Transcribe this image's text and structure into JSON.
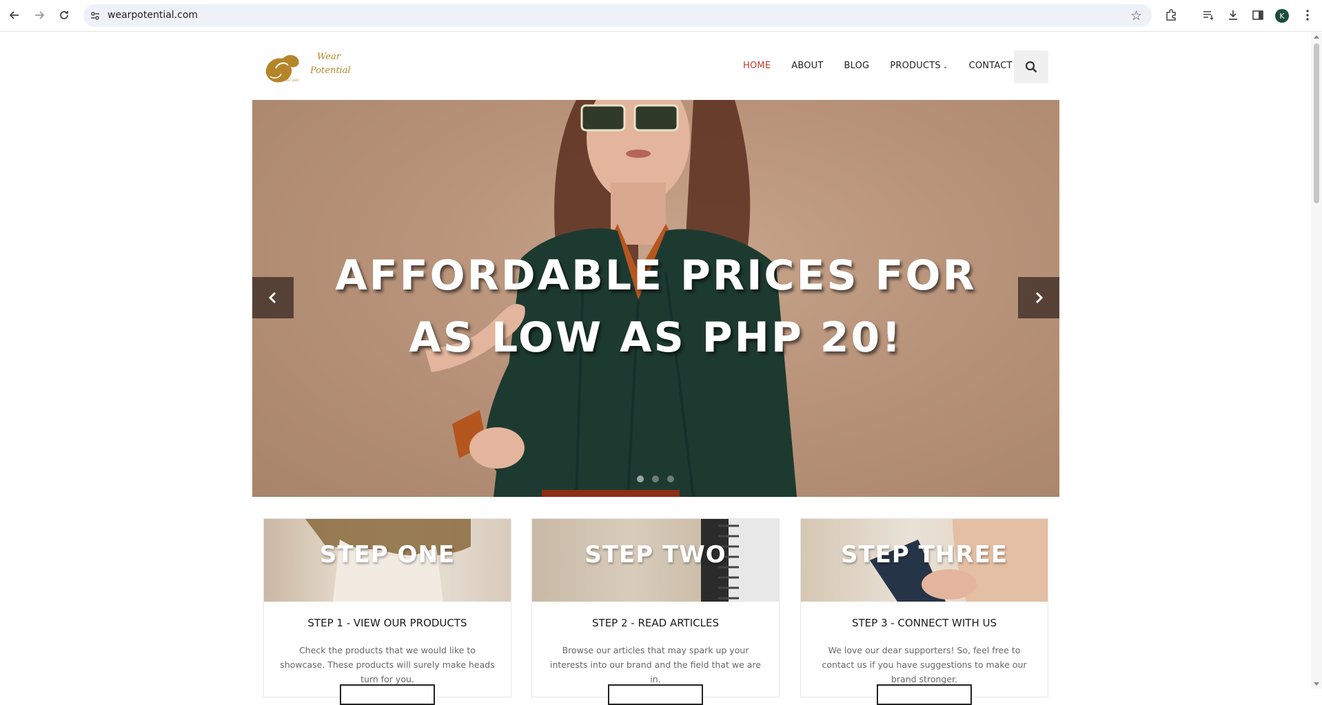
{
  "browser": {
    "url": "wearpotential.com",
    "profile_initial": "K"
  },
  "site": {
    "logo_text_1": "Wear",
    "logo_text_2": "Potential",
    "logo_small": "EST. 2022",
    "nav": [
      {
        "label": "HOME",
        "active": true
      },
      {
        "label": "ABOUT",
        "active": false
      },
      {
        "label": "BLOG",
        "active": false
      },
      {
        "label": "PRODUCTS",
        "active": false,
        "has_dropdown": true
      },
      {
        "label": "CONTACT",
        "active": false
      }
    ],
    "search_icon": "search-icon"
  },
  "hero": {
    "line1": "AFFORDABLE PRICES FOR",
    "line2": "AS LOW AS PHP 20!",
    "slide_count": 3,
    "active_slide": 1
  },
  "cards": [
    {
      "image_label": "STEP ONE",
      "title": "STEP 1 - VIEW OUR PRODUCTS",
      "desc": "Check the products that we would like to showcase. These products will surely make heads turn for you."
    },
    {
      "image_label": "STEP TWO",
      "title": "STEP 2 - READ ARTICLES",
      "desc": "Browse our articles that may spark up your interests into our brand and the field that we are in."
    },
    {
      "image_label": "STEP THREE",
      "title": "STEP 3 - CONNECT WITH US",
      "desc": "We love our dear supporters! So, feel free to contact us if you have suggestions to make our brand stronger."
    }
  ],
  "colors": {
    "accent": "#c0392b",
    "logo_gold": "#b5852a",
    "hero_bg": "#b8937a"
  }
}
